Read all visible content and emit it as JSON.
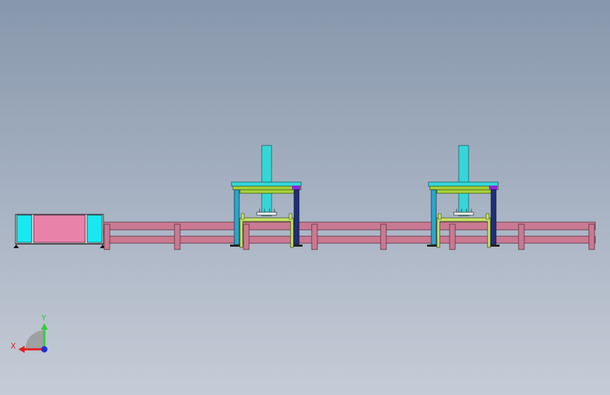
{
  "model": {
    "conveyor_leg_count": 8,
    "gantry_count": 2
  },
  "triad": {
    "x_label": "X",
    "y_label": "Y",
    "x_color": "#e0201c",
    "y_color": "#2fcf3a",
    "z_color": "#1f2fd6"
  },
  "colors": {
    "rail": "#c97a92",
    "rail_edge": "#5a2e3f",
    "cabinet_body": "#e882a8",
    "cabinet_side": "#19e8f0",
    "gantry_cyan": "#35d6d8",
    "gantry_beam": "#a6d13a",
    "column_left": "#2aa6cc",
    "column_right": "#1f2f7a",
    "bracket": "#8a2bd6",
    "fixture": "#c8e26a"
  }
}
